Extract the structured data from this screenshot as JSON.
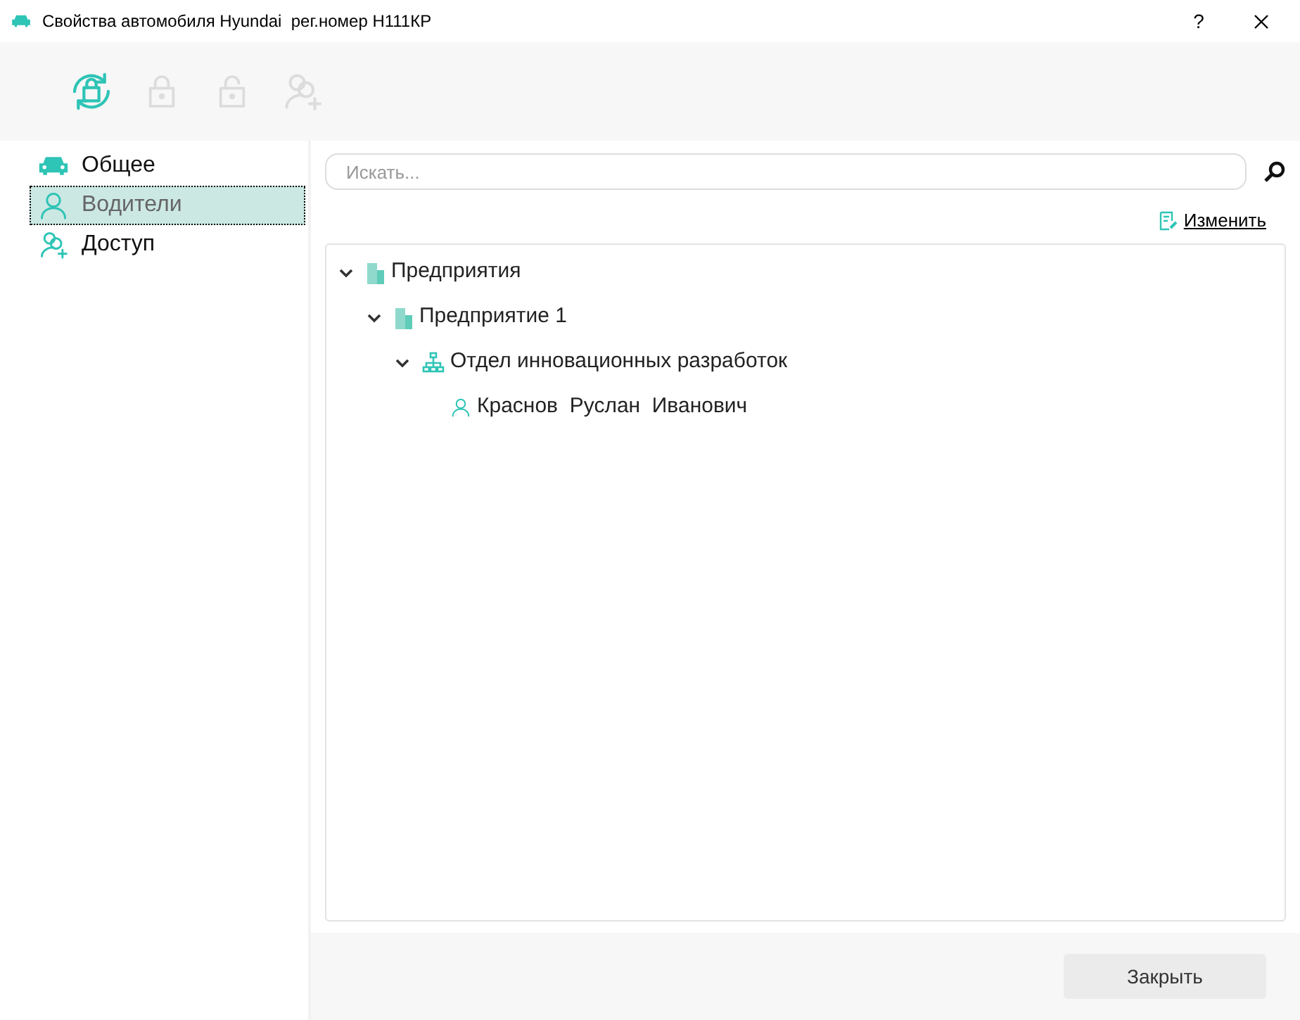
{
  "window": {
    "title": "Свойства автомобиля Hyundai  рег.номер Н111КР",
    "help": "?"
  },
  "toolbar": [
    {
      "kind": "sync-lock",
      "disabled": false
    },
    {
      "kind": "lock",
      "disabled": true
    },
    {
      "kind": "unlock",
      "disabled": true
    },
    {
      "kind": "add-user",
      "disabled": true
    }
  ],
  "sidebar": {
    "items": [
      {
        "kind": "car",
        "label": "Общее",
        "selected": false
      },
      {
        "kind": "person",
        "label": "Водители",
        "selected": true
      },
      {
        "kind": "access",
        "label": "Доступ",
        "selected": false
      }
    ]
  },
  "search": {
    "placeholder": "Искать..."
  },
  "edit_link": "Изменить",
  "tree": [
    {
      "kind": "enterprise",
      "label": "Предприятия",
      "expanded": true,
      "children": [
        {
          "kind": "enterprise",
          "label": "Предприятие 1",
          "expanded": true,
          "children": [
            {
              "kind": "department",
              "label": "Отдел инновационных разработок",
              "expanded": true,
              "children": [
                {
                  "kind": "person",
                  "label": "Краснов  Руслан  Иванович"
                }
              ]
            }
          ]
        }
      ]
    }
  ],
  "buttons": [
    "Закрыть"
  ]
}
